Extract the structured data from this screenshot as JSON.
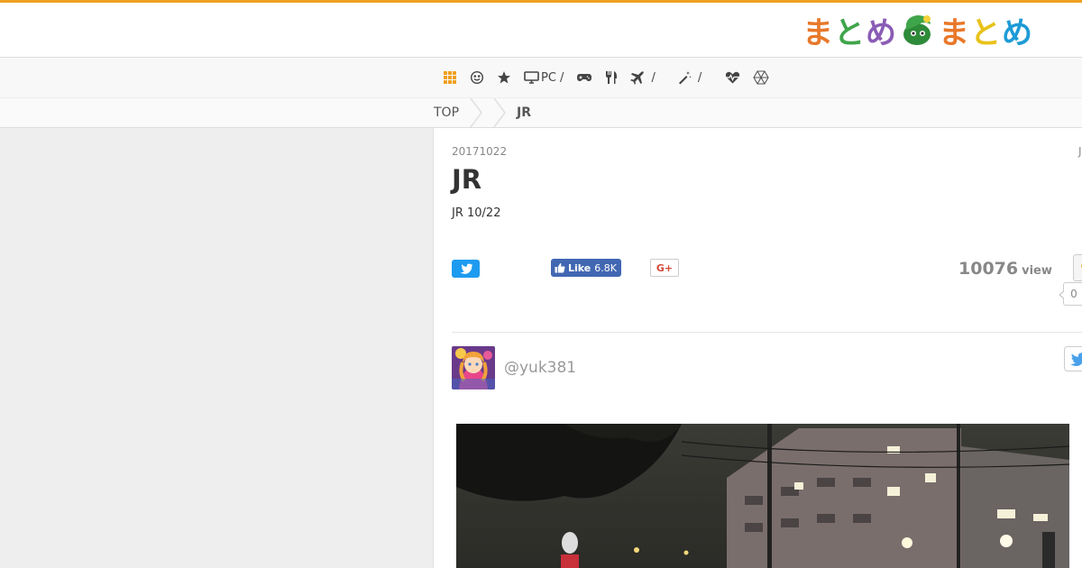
{
  "header": {
    "logo_text": "まとめまとめ",
    "logo_chars": [
      {
        "ch": "ま",
        "color": "#e8782a"
      },
      {
        "ch": "と",
        "color": "#3fa54a"
      },
      {
        "ch": "め",
        "color": "#8a5cb5"
      },
      {
        "ch": "ま",
        "color": "#e8782a"
      },
      {
        "ch": "と",
        "color": "#e8c21a"
      },
      {
        "ch": "め",
        "color": "#1d9bd6"
      }
    ],
    "accent_color": "#f0a01e"
  },
  "nav": {
    "items": [
      {
        "icon": "grid-icon",
        "label": ""
      },
      {
        "icon": "smiley-icon",
        "label": ""
      },
      {
        "icon": "star-icon",
        "label": ""
      },
      {
        "icon": "monitor-icon",
        "label": "PC /"
      },
      {
        "icon": "gamepad-icon",
        "label": ""
      },
      {
        "icon": "utensils-icon",
        "label": ""
      },
      {
        "icon": "plane-icon",
        "label": "/"
      },
      {
        "icon": "magic-wand-icon",
        "label": "/"
      },
      {
        "icon": "heartbeat-icon",
        "label": ""
      },
      {
        "icon": "hexagon-icon",
        "label": ""
      }
    ]
  },
  "breadcrumb": {
    "items": [
      "TOP",
      "JR"
    ]
  },
  "article": {
    "date": "20171022",
    "date_right": "J",
    "title": "JR",
    "subtitle": "JR 10/22",
    "facebook_label": "Like",
    "facebook_count": "6.8K",
    "google_label": "G+",
    "view_count": "10076",
    "view_unit": "view",
    "favorite_count": "0",
    "author_handle": "@yuk381"
  }
}
